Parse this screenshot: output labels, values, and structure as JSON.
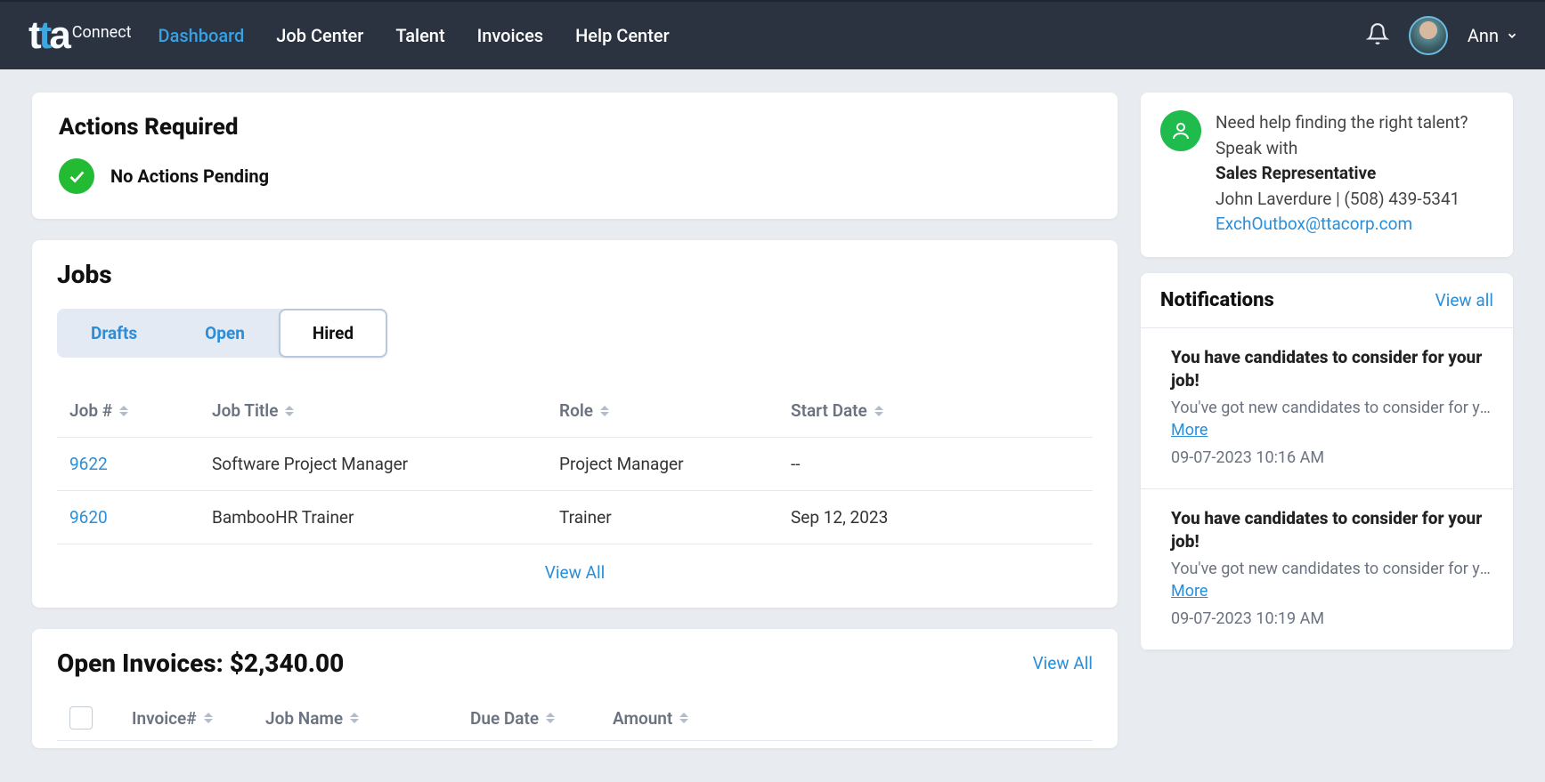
{
  "brand": {
    "connect": "Connect"
  },
  "nav": {
    "dashboard": "Dashboard",
    "job_center": "Job Center",
    "talent": "Talent",
    "invoices": "Invoices",
    "help_center": "Help Center"
  },
  "user": {
    "name": "Ann"
  },
  "actions": {
    "heading": "Actions Required",
    "status": "No Actions Pending"
  },
  "jobs": {
    "heading": "Jobs",
    "tabs": {
      "drafts": "Drafts",
      "open": "Open",
      "hired": "Hired"
    },
    "columns": {
      "job_no": "Job #",
      "job_title": "Job Title",
      "role": "Role",
      "start_date": "Start Date"
    },
    "rows": [
      {
        "job_no": "9622",
        "job_title": "Software Project Manager",
        "role": "Project Manager",
        "start_date": "--"
      },
      {
        "job_no": "9620",
        "job_title": "BambooHR Trainer",
        "role": "Trainer",
        "start_date": "Sep 12, 2023"
      }
    ],
    "view_all": "View All"
  },
  "open_invoices": {
    "title_prefix": "Open Invoices: ",
    "amount": "$2,340.00",
    "view_all": "View All",
    "columns": {
      "invoice_no": "Invoice#",
      "job_name": "Job Name",
      "due_date": "Due Date",
      "amount": "Amount"
    }
  },
  "help": {
    "line1": "Need help finding the right talent?",
    "line2": "Speak with",
    "role": "Sales Representative",
    "name_phone": "John Laverdure | (508) 439-5341",
    "email": "ExchOutbox@ttacorp.com"
  },
  "notifications": {
    "heading": "Notifications",
    "view_all": "View all",
    "items": [
      {
        "title": "You have candidates to consider for your job!",
        "preview": "You've got new candidates to consider for your j...",
        "more": "More",
        "time": "09-07-2023 10:16 AM"
      },
      {
        "title": "You have candidates to consider for your job!",
        "preview": "You've got new candidates to consider for your j...",
        "more": "More",
        "time": "09-07-2023 10:19 AM"
      }
    ]
  }
}
